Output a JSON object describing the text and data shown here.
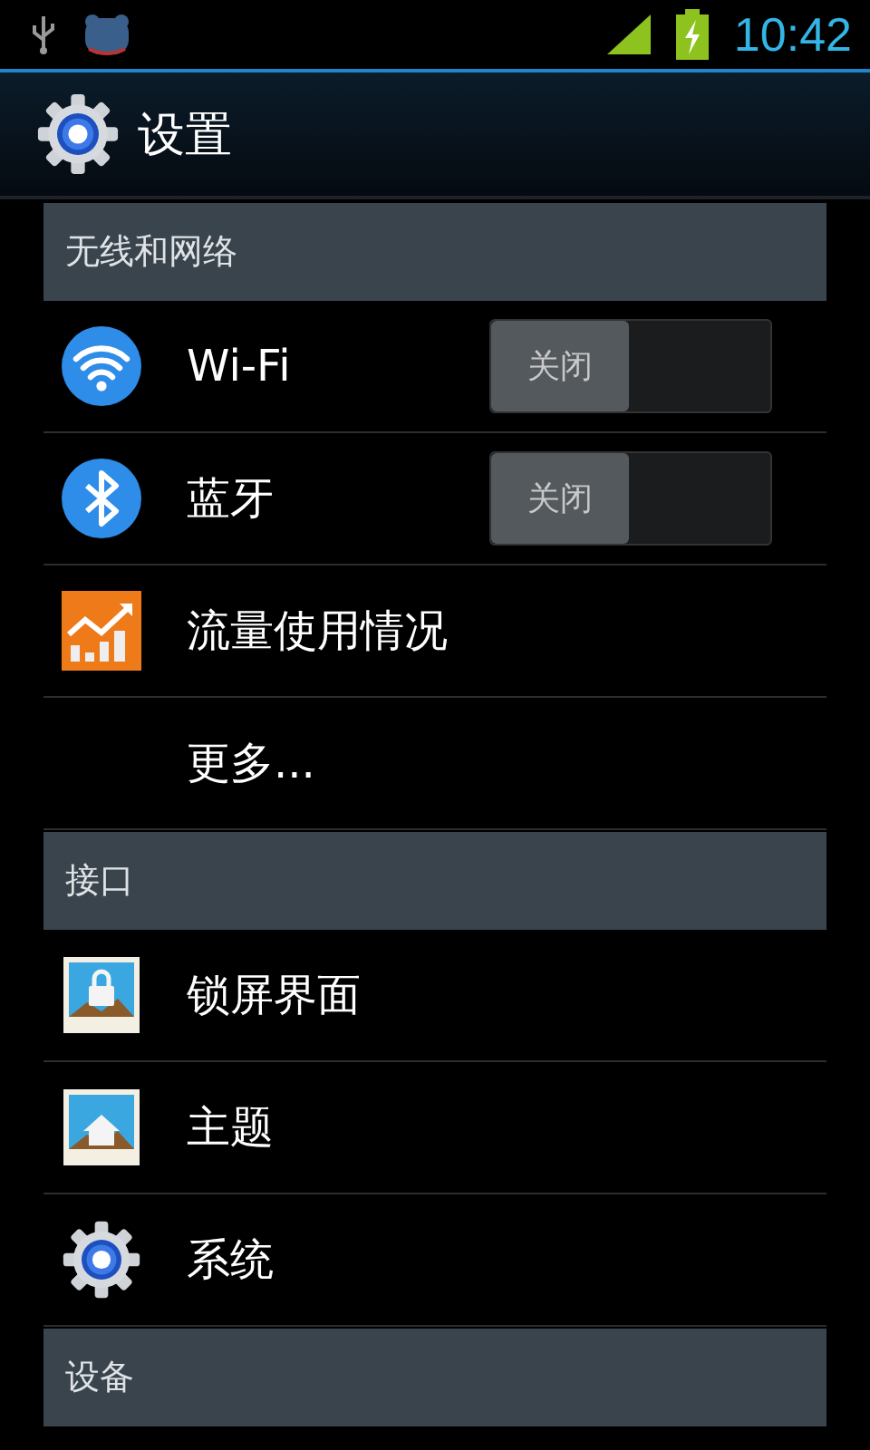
{
  "status_bar": {
    "time": "10:42"
  },
  "action_bar": {
    "title": "设置"
  },
  "sections": [
    {
      "header": "无线和网络",
      "items": [
        {
          "kind": "toggle",
          "label": "Wi-Fi",
          "toggle": {
            "on": false,
            "text": "关闭"
          }
        },
        {
          "kind": "toggle",
          "label": "蓝牙",
          "toggle": {
            "on": false,
            "text": "关闭"
          }
        },
        {
          "kind": "plain",
          "label": "流量使用情况"
        },
        {
          "kind": "noicon",
          "label": "更多..."
        }
      ]
    },
    {
      "header": "接口",
      "items": [
        {
          "kind": "plain",
          "label": "锁屏界面"
        },
        {
          "kind": "plain",
          "label": "主题"
        },
        {
          "kind": "plain",
          "label": "系统"
        }
      ]
    },
    {
      "header": "设备"
    }
  ]
}
